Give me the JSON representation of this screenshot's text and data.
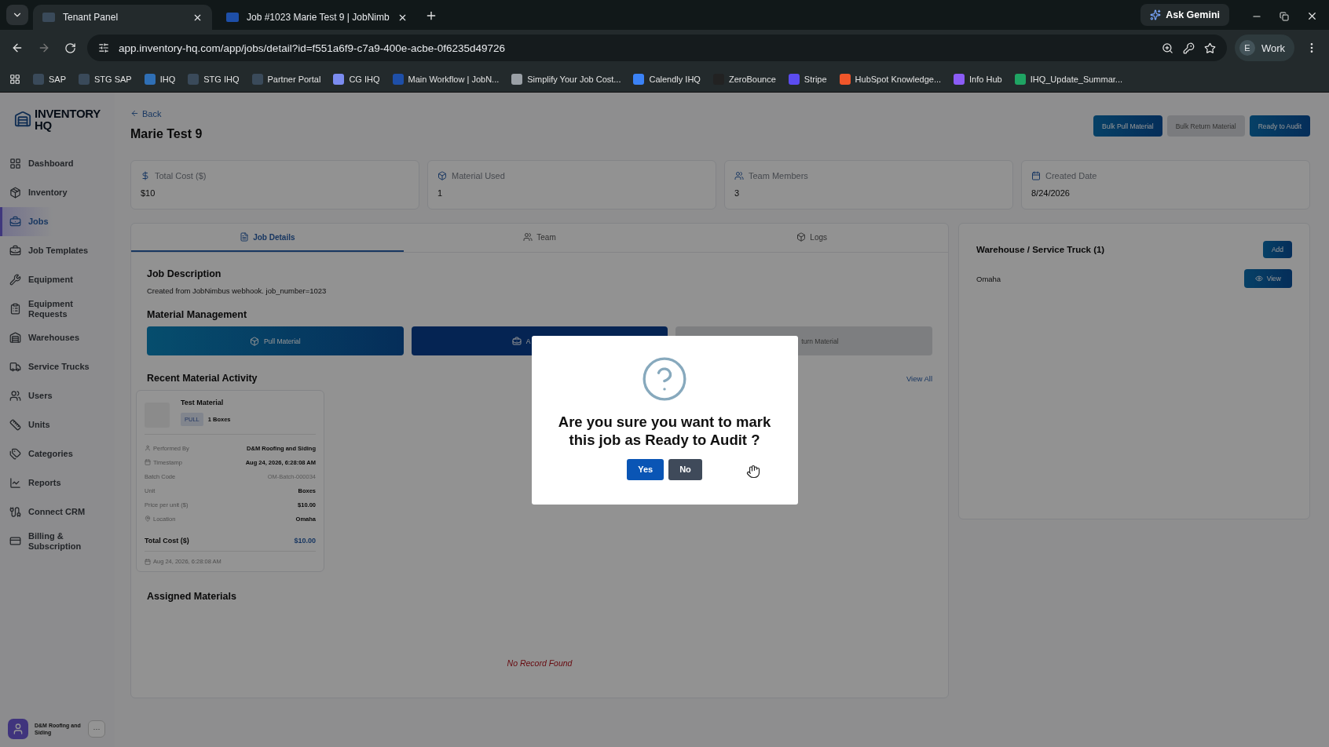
{
  "browser": {
    "tabs": [
      {
        "title": "Tenant Panel",
        "selected": true
      },
      {
        "title": "Job #1023 Marie Test 9 | JobNimb",
        "selected": false
      }
    ],
    "ask_button": "Ask Gemini",
    "url": "app.inventory-hq.com/app/jobs/detail?id=f551a6f9-c7a9-400e-acbe-0f6235d49726",
    "profile": {
      "initial": "E",
      "label": "Work"
    },
    "bookmarks": [
      {
        "label": "SAP",
        "color": "#3a4a5a"
      },
      {
        "label": "STG SAP",
        "color": "#3a4a5a"
      },
      {
        "label": "IHQ",
        "color": "#2f6fb5"
      },
      {
        "label": "STG IHQ",
        "color": "#3a4a5a"
      },
      {
        "label": "Partner Portal",
        "color": "#3a4a5a"
      },
      {
        "label": "CG IHQ",
        "color": "#7b8cf0"
      },
      {
        "label": "Main Workflow | JobN...",
        "color": "#1e4fa8"
      },
      {
        "label": "Simplify Your Job Cost...",
        "color": "#9aa0a6"
      },
      {
        "label": "Calendly IHQ",
        "color": "#3b82f6"
      },
      {
        "label": "ZeroBounce",
        "color": "#222222"
      },
      {
        "label": "Stripe",
        "color": "#5b4cf0"
      },
      {
        "label": "HubSpot Knowledge...",
        "color": "#f0562a"
      },
      {
        "label": "Info Hub",
        "color": "#8b5cf6"
      },
      {
        "label": "IHQ_Update_Summar...",
        "color": "#1fa463"
      }
    ]
  },
  "sidebar": {
    "logo": {
      "line1": "INVENTORY",
      "line2": "HQ"
    },
    "items": [
      {
        "label": "Dashboard",
        "selected": false
      },
      {
        "label": "Inventory",
        "selected": false
      },
      {
        "label": "Jobs",
        "selected": true
      },
      {
        "label": "Job Templates",
        "selected": false
      },
      {
        "label": "Equipment",
        "selected": false
      },
      {
        "label": "Equipment Requests",
        "selected": false
      },
      {
        "label": "Warehouses",
        "selected": false
      },
      {
        "label": "Service Trucks",
        "selected": false
      },
      {
        "label": "Users",
        "selected": false
      },
      {
        "label": "Units",
        "selected": false
      },
      {
        "label": "Categories",
        "selected": false
      },
      {
        "label": "Reports",
        "selected": false
      },
      {
        "label": "Connect CRM",
        "selected": false
      },
      {
        "label": "Billing & Subscription",
        "selected": false
      }
    ],
    "account": {
      "name": "D&M Roofing and Siding",
      "more": "···"
    }
  },
  "header": {
    "back": "Back",
    "title": "Marie Test 9",
    "buttons": [
      {
        "label": "Bulk Pull Material",
        "kind": "primary"
      },
      {
        "label": "Bulk Return Material",
        "kind": "muted"
      },
      {
        "label": "Ready to Audit",
        "kind": "primary"
      }
    ]
  },
  "stats": [
    {
      "label": "Total Cost ($)",
      "value": "$10"
    },
    {
      "label": "Material Used",
      "value": "1"
    },
    {
      "label": "Team Members",
      "value": "3"
    },
    {
      "label": "Created Date",
      "value": "8/24/2026"
    }
  ],
  "tabs": [
    {
      "label": "Job Details",
      "selected": true
    },
    {
      "label": "Team",
      "selected": false
    },
    {
      "label": "Logs",
      "selected": false
    }
  ],
  "job_description": {
    "heading": "Job Description",
    "text": "Created from JobNimbus webhook. job_number=1023"
  },
  "material_management": {
    "heading": "Material Management",
    "buttons": [
      {
        "label": "Pull Material",
        "kind": "pull"
      },
      {
        "label": "A",
        "kind": "assign"
      },
      {
        "label": "turn Material",
        "kind": "muted"
      }
    ]
  },
  "recent_activity": {
    "heading": "Recent Material Activity",
    "view_all": "View All",
    "card": {
      "name": "Test Material",
      "type": "PULL",
      "quantity": "1 Boxes",
      "details": [
        {
          "label": "Performed By",
          "value": "D&M Roofing and Siding"
        },
        {
          "label": "Timestamp",
          "value": "Aug 24, 2026, 6:28:08 AM"
        },
        {
          "label": "Batch Code",
          "value": "OM-Batch-000034",
          "muted": true
        },
        {
          "label": "Unit",
          "value": "Boxes"
        },
        {
          "label": "Price per unit ($)",
          "value": "$10.00"
        },
        {
          "label": "Location",
          "value": "Omaha"
        }
      ],
      "total_label": "Total Cost ($)",
      "total_value": "$10.00",
      "footer": "Aug 24, 2026, 6:28:08 AM"
    }
  },
  "assigned_materials": {
    "heading": "Assigned Materials",
    "empty": "No Record Found"
  },
  "warehouse_panel": {
    "heading": "Warehouse / Service Truck (1)",
    "add": "Add",
    "rows": [
      {
        "name": "Omaha",
        "action": "View"
      }
    ]
  },
  "dialog": {
    "message": "Are you sure you want to mark this job as Ready to Audit ?",
    "confirm": "Yes",
    "cancel": "No"
  }
}
